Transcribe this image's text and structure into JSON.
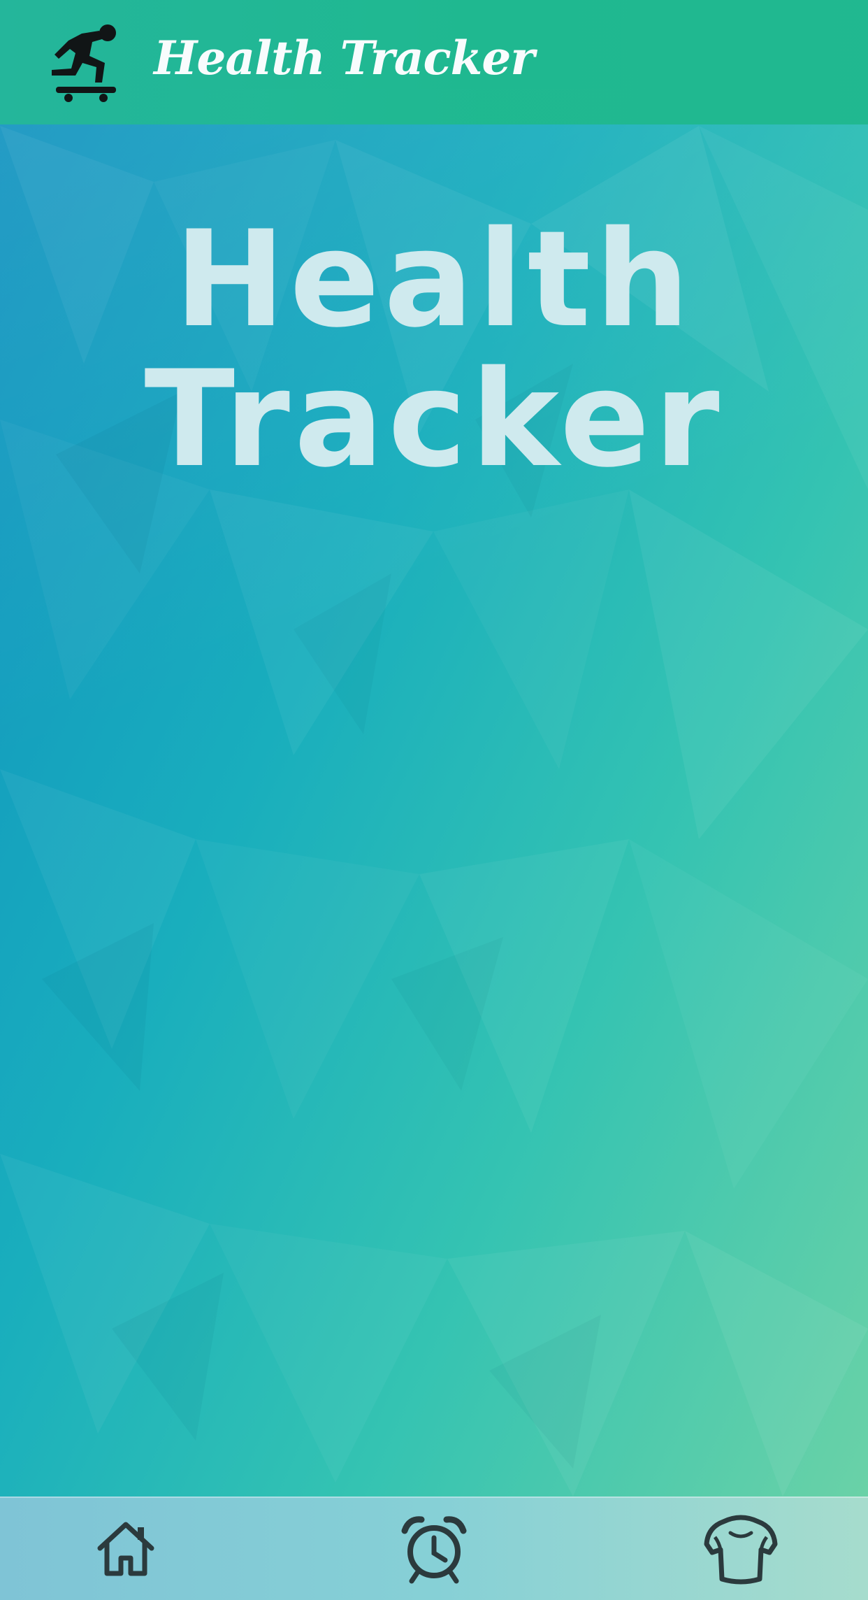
{
  "header": {
    "title": "Health Tracker",
    "logo_icon": "skateboarder-icon"
  },
  "hero": {
    "line1": "Health",
    "line2": "Tracker"
  },
  "bottom_nav": {
    "items": [
      {
        "icon": "home-icon"
      },
      {
        "icon": "alarm-clock-icon"
      },
      {
        "icon": "muscle-body-icon"
      }
    ]
  },
  "colors": {
    "header_bg": "#1fb98f",
    "hero_text": "#cfeaee",
    "nav_icon": "#2b3a3d"
  }
}
